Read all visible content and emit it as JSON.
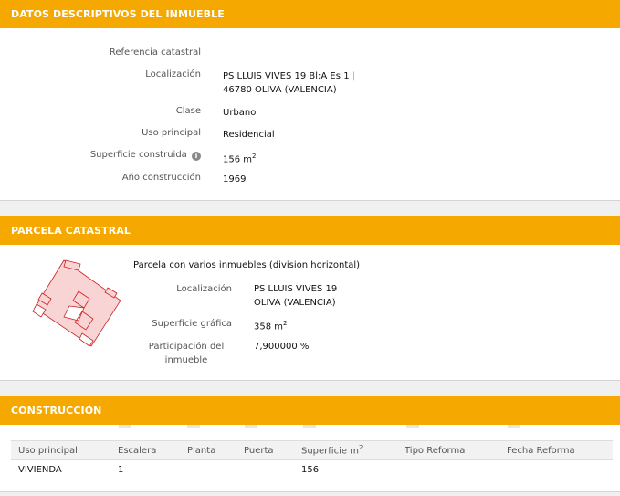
{
  "descriptivos": {
    "header": "DATOS DESCRIPTIVOS DEL INMUEBLE",
    "rows": [
      {
        "label": "Referencia catastral",
        "value": ""
      },
      {
        "label": "Localización",
        "value": "PS LLUIS VIVES 19 Bl:A Es:1",
        "value2": "46780 OLIVA (VALENCIA)"
      },
      {
        "label": "Clase",
        "value": "Urbano"
      },
      {
        "label": "Uso principal",
        "value": "Residencial"
      },
      {
        "label": "Superficie construida",
        "value": "156 m",
        "unit_sup": "2"
      },
      {
        "label": "Año construcción",
        "value": "1969"
      }
    ],
    "info_icon": "info-icon",
    "cursor": "|"
  },
  "parcela": {
    "header": "PARCELA CATASTRAL",
    "title": "Parcela con varios inmuebles (division horizontal)",
    "loc_label": "Localización",
    "loc_value1": "PS LLUIS VIVES 19",
    "loc_value2": "OLIVA (VALENCIA)",
    "sup_label": "Superficie gráfica",
    "sup_value": "358 m",
    "sup_unit": "2",
    "part_label1": "Participación del",
    "part_label2": "inmueble",
    "part_value": "7,900000 %"
  },
  "construccion": {
    "header": "CONSTRUCCIÓN",
    "columns": [
      "Uso principal",
      "Escalera",
      "Planta",
      "Puerta",
      "Superficie m",
      "Tipo Reforma",
      "Fecha Reforma"
    ],
    "sup_col_unit": "2",
    "rows": [
      [
        "VIVIENDA",
        "1",
        "",
        "",
        "156",
        "",
        ""
      ]
    ]
  },
  "colors": {
    "accent": "#f5a800",
    "parcel_fill": "#f8d4d4",
    "parcel_stroke": "#d02020"
  }
}
